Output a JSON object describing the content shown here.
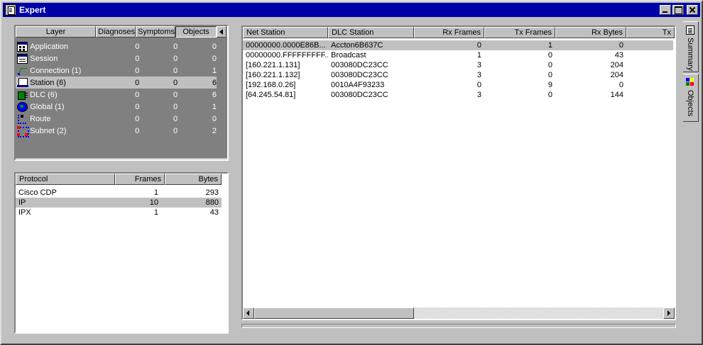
{
  "window": {
    "title": "Expert"
  },
  "layer_panel": {
    "headers": [
      "Layer",
      "Diagnoses",
      "Symptoms",
      "Objects"
    ],
    "rows": [
      {
        "icon": "application-icon",
        "name": "Application",
        "diagnoses": "0",
        "symptoms": "0",
        "objects": "0"
      },
      {
        "icon": "session-icon",
        "name": "Session",
        "diagnoses": "0",
        "symptoms": "0",
        "objects": "0"
      },
      {
        "icon": "connection-icon",
        "name": "Connection (1)",
        "diagnoses": "0",
        "symptoms": "0",
        "objects": "1"
      },
      {
        "icon": "station-icon",
        "name": "Station (6)",
        "diagnoses": "0",
        "symptoms": "0",
        "objects": "6",
        "selected": true
      },
      {
        "icon": "dlc-icon",
        "name": "DLC (6)",
        "diagnoses": "0",
        "symptoms": "0",
        "objects": "6"
      },
      {
        "icon": "globe-icon",
        "name": "Global (1)",
        "diagnoses": "0",
        "symptoms": "0",
        "objects": "1"
      },
      {
        "icon": "route-icon",
        "name": "Route",
        "diagnoses": "0",
        "symptoms": "0",
        "objects": "0"
      },
      {
        "icon": "subnet-icon",
        "name": "Subnet (2)",
        "diagnoses": "0",
        "symptoms": "0",
        "objects": "2"
      }
    ]
  },
  "protocol_panel": {
    "headers": [
      "Protocol",
      "Frames",
      "Bytes"
    ],
    "rows": [
      {
        "protocol": "Cisco CDP",
        "frames": "1",
        "bytes": "293"
      },
      {
        "protocol": "IP",
        "frames": "10",
        "bytes": "880",
        "selected": true
      },
      {
        "protocol": "IPX",
        "frames": "1",
        "bytes": "43"
      }
    ]
  },
  "station_table": {
    "headers": [
      "Net Station",
      "DLC Station",
      "Rx Frames",
      "Tx Frames",
      "Rx Bytes",
      "Tx"
    ],
    "rows": [
      {
        "net": "00000000.0000E86B...",
        "dlc": "Accton6B637C",
        "rx_frames": "0",
        "tx_frames": "1",
        "rx_bytes": "0",
        "selected": true
      },
      {
        "net": "00000000.FFFFFFFFF...",
        "dlc": "Broadcast",
        "rx_frames": "1",
        "tx_frames": "0",
        "rx_bytes": "43"
      },
      {
        "net": "[160.221.1.131]",
        "dlc": "003080DC23CC",
        "rx_frames": "3",
        "tx_frames": "0",
        "rx_bytes": "204"
      },
      {
        "net": "[160.221.1.132]",
        "dlc": "003080DC23CC",
        "rx_frames": "3",
        "tx_frames": "0",
        "rx_bytes": "204"
      },
      {
        "net": "[192.168.0.26]",
        "dlc": "0010A4F93233",
        "rx_frames": "0",
        "tx_frames": "9",
        "rx_bytes": "0"
      },
      {
        "net": "[64.245.54.81]",
        "dlc": "003080DC23CC",
        "rx_frames": "3",
        "tx_frames": "0",
        "rx_bytes": "144"
      }
    ]
  },
  "side_tabs": [
    {
      "label": "Summary",
      "icon": "summary-icon",
      "active": true
    },
    {
      "label": "Objects",
      "icon": "objects-icon",
      "active": false
    }
  ]
}
